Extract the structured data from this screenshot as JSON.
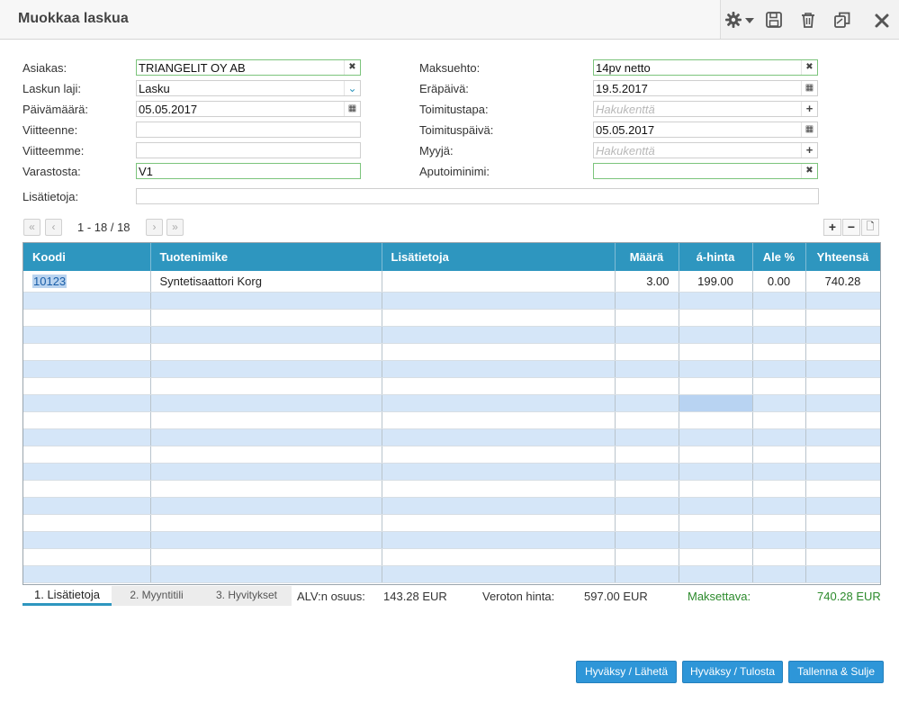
{
  "window": {
    "title": "Muokkaa laskua"
  },
  "toolbar": {
    "icons": [
      "gear-dropdown-icon",
      "save-icon",
      "trash-icon",
      "copy-icon",
      "close-icon"
    ]
  },
  "form": {
    "asiakas_label": "Asiakas:",
    "asiakas_value": "TRIANGELIT OY AB",
    "laskun_laji_label": "Laskun laji:",
    "laskun_laji_value": "Lasku",
    "paivamaara_label": "Päivämäärä:",
    "paivamaara_value": "05.05.2017",
    "viitteenne_label": "Viitteenne:",
    "viitteenne_value": "",
    "viitteemme_label": "Viitteemme:",
    "viitteemme_value": "",
    "varastosta_label": "Varastosta:",
    "varastosta_value": "V1",
    "lisatietoja_label": "Lisätietoja:",
    "lisatietoja_value": "",
    "maksuehto_label": "Maksuehto:",
    "maksuehto_value": "14pv netto",
    "erapaiva_label": "Eräpäivä:",
    "erapaiva_value": "19.5.2017",
    "toimitustapa_label": "Toimitustapa:",
    "toimitustapa_placeholder": "Hakukenttä",
    "toimituspaiva_label": "Toimituspäivä:",
    "toimituspaiva_value": "05.05.2017",
    "myyja_label": "Myyjä:",
    "myyja_placeholder": "Hakukenttä",
    "aputoiminimi_label": "Aputoiminimi:",
    "aputoiminimi_value": ""
  },
  "pager": {
    "text": "1 - 18 / 18"
  },
  "grid": {
    "columns": [
      "Koodi",
      "Tuotenimike",
      "Lisätietoja",
      "Määrä",
      "á-hinta",
      "Ale %",
      "Yhteensä"
    ],
    "rows": [
      {
        "koodi": "10123",
        "tuotenimike": "Syntetisaattori Korg",
        "lisatietoja": "",
        "maara": "3.00",
        "ahinta": "199.00",
        "ale": "0.00",
        "yhteensa": "740.28"
      }
    ]
  },
  "tabs": [
    "1. Lisätietoja",
    "2. Myyntitili",
    "3. Hyvitykset"
  ],
  "summary": {
    "alv_label": "ALV:n osuus:",
    "alv_value": "143.28 EUR",
    "veroton_label": "Veroton hinta:",
    "veroton_value": "597.00 EUR",
    "maksettava_label": "Maksettava:",
    "maksettava_value": "740.28 EUR"
  },
  "buttons": {
    "hyvaksy_laheta": "Hyväksy / Lähetä",
    "hyvaksy_tulosta": "Hyväksy / Tulosta",
    "tallenna_sulje": "Tallenna & Sulje"
  },
  "colors": {
    "header": "#2e96bf",
    "alt_row": "#d5e6f8",
    "button": "#2e96d8",
    "valid": "#7cc47c",
    "total_green": "#2c8a2c"
  }
}
